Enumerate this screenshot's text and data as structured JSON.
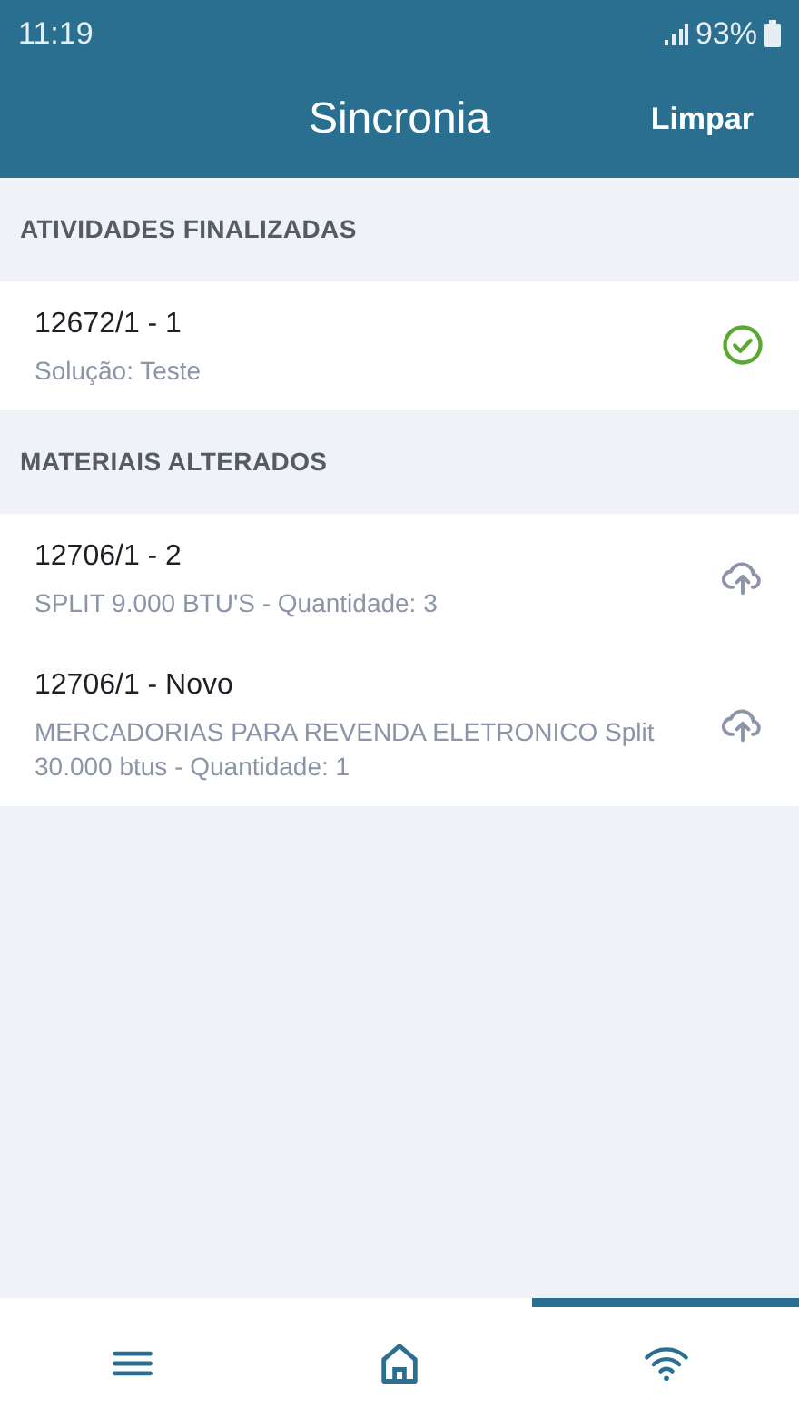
{
  "status_bar": {
    "time": "11:19",
    "battery": "93%"
  },
  "header": {
    "title": "Sincronia",
    "action": "Limpar"
  },
  "sections": [
    {
      "title": "ATIVIDADES FINALIZADAS",
      "items": [
        {
          "title": "12672/1 - 1",
          "subtitle": "Solução: Teste",
          "kind": "done"
        }
      ]
    },
    {
      "title": "MATERIAIS ALTERADOS",
      "items": [
        {
          "title": "12706/1 - 2",
          "subtitle": "SPLIT 9.000 BTU'S - Quantidade: 3",
          "kind": "upload"
        },
        {
          "title": "12706/1 - Novo",
          "subtitle": "MERCADORIAS PARA REVENDA ELETRONICO Split 30.000 btus - Quantidade: 1",
          "kind": "upload"
        }
      ]
    }
  ],
  "tabs": [
    {
      "kind": "menu",
      "selected": false
    },
    {
      "kind": "home",
      "selected": false
    },
    {
      "kind": "sync",
      "selected": true
    }
  ]
}
